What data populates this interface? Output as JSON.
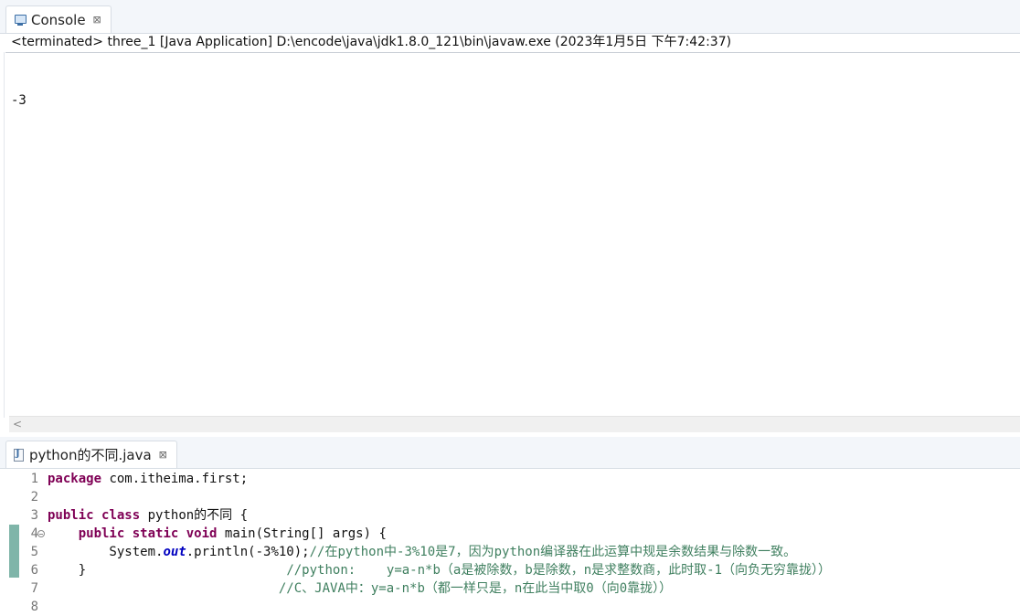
{
  "console": {
    "tab_label": "Console",
    "tab_close": "⊠",
    "status_text": "<terminated> three_1 [Java Application] D:\\encode\\java\\jdk1.8.0_121\\bin\\javaw.exe (2023年1月5日 下午7:42:37)",
    "output_lines": [
      "-3"
    ],
    "scroll_left_glyph": "<"
  },
  "editor": {
    "tab_label": "python的不同.java",
    "tab_close": "⊠",
    "line_numbers": [
      "1",
      "2",
      "3",
      "4",
      "5",
      "6",
      "7",
      "8"
    ],
    "code": {
      "l1_kw": "package",
      "l1_rest": " com.itheima.first;",
      "l3_kw1": "public",
      "l3_sp": " ",
      "l3_kw2": "class",
      "l3_rest": " python的不同 {",
      "l4_indent": "    ",
      "l4_kw1": "public",
      "l4_sp1": " ",
      "l4_kw2": "static",
      "l4_sp2": " ",
      "l4_kw3": "void",
      "l4_rest": " main(String[] args) {",
      "l5_pre": "        System.",
      "l5_field": "out",
      "l5_mid": ".println(-3%10);",
      "l5_comment": "//在python中-3%10是7，因为python编译器在此运算中规是余数结果与除数一致。",
      "l6_brace": "    }",
      "l6_pad": "                          ",
      "l6_comment": "//python:    y=a-n*b（a是被除数，b是除数，n是求整数商，此时取-1（向负无穷靠拢））",
      "l7_pad": "                              ",
      "l7_comment": "//C、JAVA中：y=a-n*b（都一样只是，n在此当中取0（向0靠拢））"
    }
  }
}
